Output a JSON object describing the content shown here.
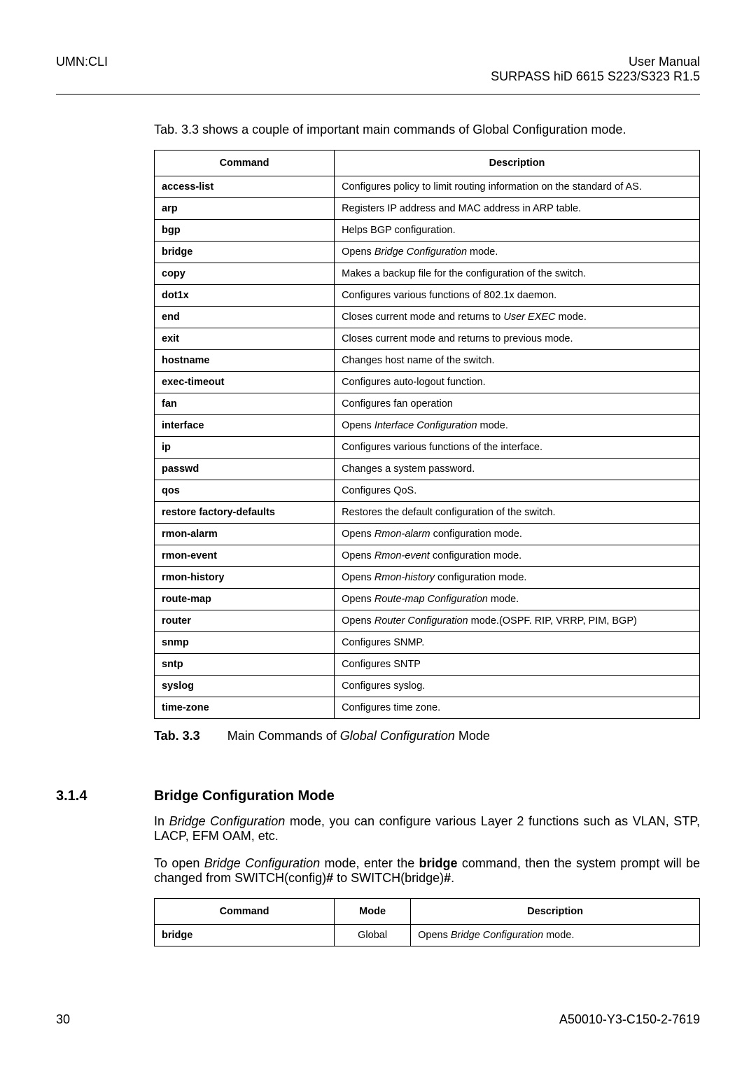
{
  "header": {
    "left": "UMN:CLI",
    "right1": "User Manual",
    "right2": "SURPASS hiD 6615 S223/S323 R1.5"
  },
  "intro": "Tab. 3.3 shows a couple of important main commands of Global Configuration mode.",
  "table1": {
    "head": {
      "command": "Command",
      "desc": "Description"
    },
    "rows": [
      {
        "cmd": "access-list",
        "desc": "Configures policy to limit routing information on the standard of AS."
      },
      {
        "cmd": "arp",
        "desc": "Registers IP address and MAC address in ARP table."
      },
      {
        "cmd": "bgp",
        "desc": "Helps BGP configuration."
      },
      {
        "cmd": "bridge",
        "desc_pre": "Opens ",
        "desc_em": "Bridge Configuration",
        "desc_post": " mode."
      },
      {
        "cmd": "copy",
        "desc": "Makes a backup file for the configuration of the switch."
      },
      {
        "cmd": "dot1x",
        "desc": "Configures various functions of 802.1x daemon."
      },
      {
        "cmd": "end",
        "desc_pre": "Closes current mode and returns to ",
        "desc_em": "User EXEC",
        "desc_post": " mode."
      },
      {
        "cmd": "exit",
        "desc": "Closes current mode and returns to previous mode."
      },
      {
        "cmd": "hostname",
        "desc": "Changes host name of the switch."
      },
      {
        "cmd": "exec-timeout",
        "desc": "Configures auto-logout function."
      },
      {
        "cmd": "fan",
        "desc": "Configures fan operation"
      },
      {
        "cmd": "interface",
        "desc_pre": "Opens ",
        "desc_em": "Interface Configuration",
        "desc_post": " mode."
      },
      {
        "cmd": "ip",
        "desc": "Configures various functions of the interface."
      },
      {
        "cmd": "passwd",
        "desc": "Changes a system password."
      },
      {
        "cmd": "qos",
        "desc": "Configures QoS."
      },
      {
        "cmd": "restore factory-defaults",
        "desc": "Restores the default configuration of the switch."
      },
      {
        "cmd": "rmon-alarm",
        "desc_pre": "Opens ",
        "desc_em": "Rmon-alarm",
        "desc_post": " configuration mode."
      },
      {
        "cmd": "rmon-event",
        "desc_pre": "Opens ",
        "desc_em": "Rmon-event",
        "desc_post": " configuration mode."
      },
      {
        "cmd": "rmon-history",
        "desc_pre": "Opens ",
        "desc_em": "Rmon-history",
        "desc_post": " configuration mode."
      },
      {
        "cmd": "route-map",
        "desc_pre": "Opens ",
        "desc_em": "Route-map Configuration",
        "desc_post": " mode."
      },
      {
        "cmd": "router",
        "desc_pre": "Opens ",
        "desc_em": "Router Configuration",
        "desc_post": " mode.(OSPF. RIP, VRRP, PIM, BGP)"
      },
      {
        "cmd": "snmp",
        "desc": "Configures SNMP."
      },
      {
        "cmd": "sntp",
        "desc": "Configures SNTP"
      },
      {
        "cmd": "syslog",
        "desc": "Configures syslog."
      },
      {
        "cmd": "time-zone",
        "desc": "Configures time zone."
      }
    ]
  },
  "caption1": {
    "label": "Tab. 3.3",
    "text_pre": "Main Commands of ",
    "text_em": "Global Configuration",
    "text_post": " Mode"
  },
  "section": {
    "num": "3.1.4",
    "title": "Bridge Configuration Mode"
  },
  "para1": {
    "pre": "In ",
    "em": "Bridge Configuration",
    "post": " mode, you can configure various Layer 2 functions such as VLAN, STP, LACP, EFM OAM, etc."
  },
  "para2": {
    "pre": "To open ",
    "em": "Bridge Configuration",
    "mid": " mode, enter the ",
    "bold": "bridge",
    "post": " command, then the system prompt will be changed from SWITCH(config)",
    "b2": "#",
    "post2": " to SWITCH(bridge)",
    "b3": "#",
    "post3": "."
  },
  "table2": {
    "head": {
      "command": "Command",
      "mode": "Mode",
      "desc": "Description"
    },
    "rows": [
      {
        "cmd": "bridge",
        "mode": "Global",
        "desc_pre": "Opens ",
        "desc_em": "Bridge Configuration",
        "desc_post": " mode."
      }
    ]
  },
  "footer": {
    "page": "30",
    "doc": "A50010-Y3-C150-2-7619"
  }
}
